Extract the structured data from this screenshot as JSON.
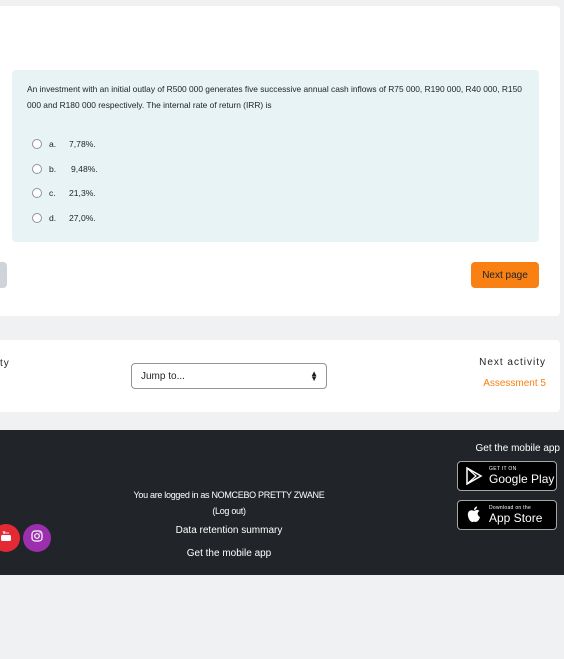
{
  "question": {
    "text": "An investment with an initial outlay of R500 000 generates five successive annual cash inflows of R75 000, R190 000, R40 000, R150 000 and R180 000 respectively. The internal rate of return (IRR) is",
    "options": [
      {
        "letter": "a.",
        "value": "7,78%."
      },
      {
        "letter": "b.",
        "value": "9,48%."
      },
      {
        "letter": "c.",
        "value": "21,3%."
      },
      {
        "letter": "d.",
        "value": "27,0%."
      }
    ]
  },
  "navigation": {
    "next_page": "Next page"
  },
  "activity_nav": {
    "prev_fragment": "ty",
    "jump_placeholder": "Jump to...",
    "next_label": "Next activity",
    "next_link": "Assessment 5"
  },
  "footer": {
    "mobile_title": "Get the mobile app",
    "google_small": "GET IT ON",
    "google_big": "Google Play",
    "apple_small": "Download on the",
    "apple_big": "App Store",
    "logged_in": "You are logged in as NOMCEBO PRETTY ZWANE (Log out)",
    "data_retention": "Data retention summary",
    "get_app": "Get the mobile app"
  },
  "colors": {
    "accent": "#f98012",
    "question_bg": "#e7f3f5",
    "footer_bg": "#212529"
  }
}
